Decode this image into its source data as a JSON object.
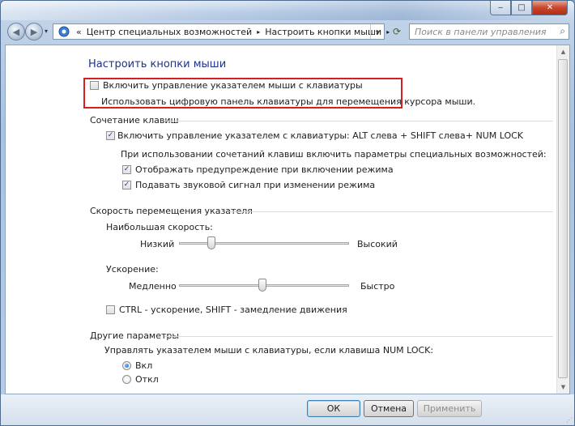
{
  "window": {
    "controls": {
      "minimize": "‒",
      "maximize": "□",
      "close": "✕"
    }
  },
  "address": {
    "root_icon": "control-panel-icon",
    "prefix": "«",
    "crumb1": "Центр специальных возможностей",
    "sep": "▸",
    "crumb2": "Настроить кнопки мыши",
    "dropdown": "▾",
    "search_placeholder": "Поиск в панели управления"
  },
  "page": {
    "title": "Настроить кнопки мыши",
    "enable_mousekeys_label": "Включить управление указателем мыши с клавиатуры",
    "enable_mousekeys_checked": false,
    "enable_description": "Использовать цифровую панель клавиатуры для перемещения курсора мыши."
  },
  "shortcut": {
    "group_label": "Сочетание клавиш",
    "hotkey_label": "Включить управление указателем с клавиатуры: ALT слева + SHIFT слева+ NUM LOCK",
    "hotkey_checked": true,
    "sub_heading": "При использовании сочетаний клавиш включить параметры специальных возможностей:",
    "warn_label": "Отображать предупреждение при включении режима",
    "warn_checked": true,
    "sound_label": "Подавать звуковой сигнал при изменении режима",
    "sound_checked": true
  },
  "speed": {
    "group_label": "Скорость перемещения указателя",
    "top_speed_label": "Наибольшая скорость:",
    "top_speed_min": "Низкий",
    "top_speed_max": "Высокий",
    "top_speed_value": 0.19,
    "accel_label": "Ускорение:",
    "accel_min": "Медленно",
    "accel_max": "Быстро",
    "accel_value": 0.49,
    "ctrl_shift_label": "CTRL - ускорение, SHIFT - замедление движения",
    "ctrl_shift_checked": false
  },
  "other": {
    "group_label": "Другие параметры",
    "numlock_label": "Управлять указателем мыши с клавиатуры, если клавиша NUM LOCK:",
    "on_label": "Вкл",
    "off_label": "Откл",
    "selected": "on"
  },
  "buttons": {
    "ok": "ОК",
    "cancel": "Отмена",
    "apply": "Применить"
  },
  "colors": {
    "title_blue": "#1e3287",
    "highlight_red": "#d7201e",
    "radio_blue": "#1a5fb4"
  }
}
